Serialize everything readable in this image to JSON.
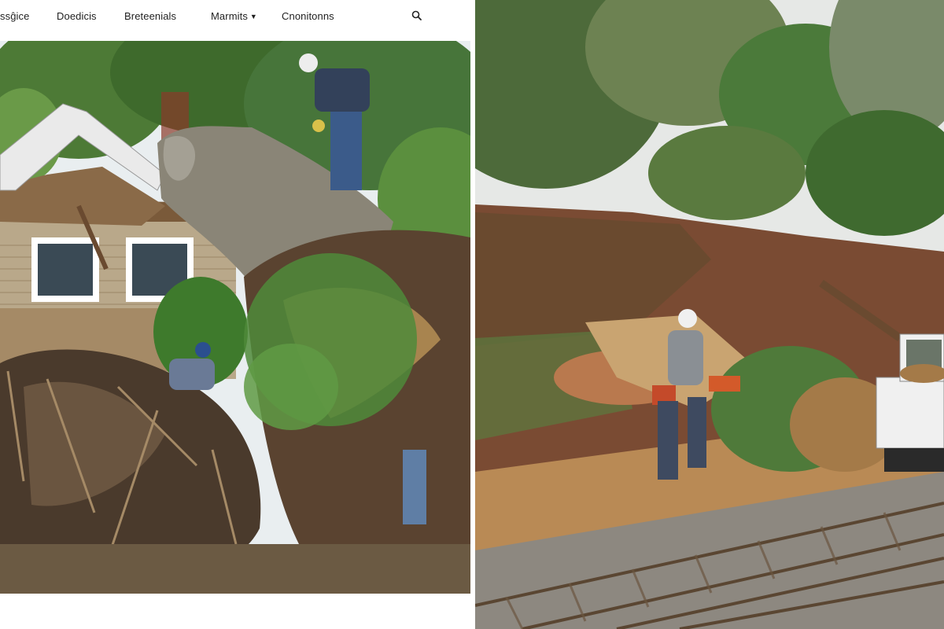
{
  "nav": {
    "items": [
      {
        "label": "ssĝice",
        "has_dropdown": false
      },
      {
        "label": "Doedicis",
        "has_dropdown": false
      },
      {
        "label": "Breteenials",
        "has_dropdown": false
      },
      {
        "label": "Marmits",
        "has_dropdown": true
      },
      {
        "label": "Cnonitonns",
        "has_dropdown": false
      }
    ],
    "search_icon": "search-icon"
  },
  "colors": {
    "sky": "#e9eef0",
    "foliage": "#3f6b2e",
    "siding": "#b9a88a",
    "wood": "#b98a55",
    "soil": "#8a5a3c",
    "rail": "#6b5640"
  }
}
